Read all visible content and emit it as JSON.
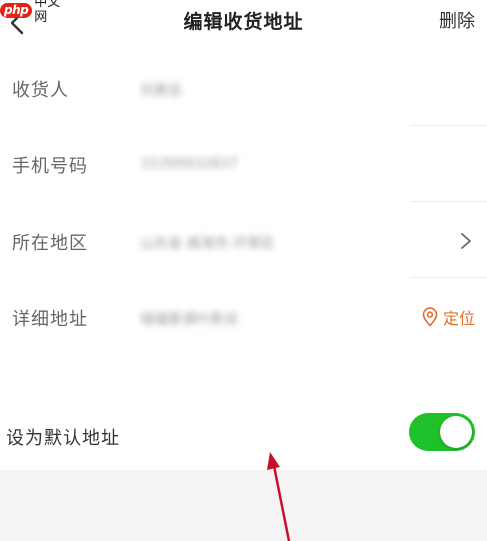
{
  "watermark": {
    "logo": "php",
    "text": "中文网"
  },
  "header": {
    "title": "编辑收货地址",
    "delete_label": "删除"
  },
  "form": {
    "receiver": {
      "label": "收货人",
      "value": "刘景岳"
    },
    "phone": {
      "label": "手机号码",
      "value": "15399932837"
    },
    "region": {
      "label": "所在地区",
      "value": "山东省 威海市 环翠区"
    },
    "address": {
      "label": "详细地址",
      "value": "瑞福客满叶斯派"
    },
    "locate_label": "定位",
    "default": {
      "label": "设为默认地址",
      "enabled": true
    }
  },
  "colors": {
    "accent_orange": "#e0702b",
    "toggle_green": "#1fc12a",
    "annotation_red": "#c8102e"
  },
  "icons": [
    "back-chevron-icon",
    "chevron-right-icon",
    "location-pin-icon"
  ]
}
